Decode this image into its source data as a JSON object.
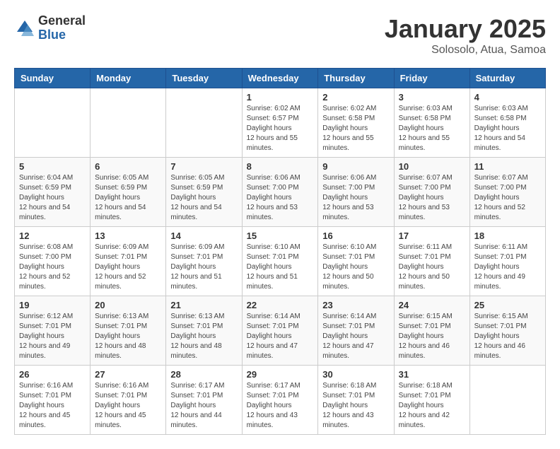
{
  "header": {
    "logo": {
      "general": "General",
      "blue": "Blue"
    },
    "title": "January 2025",
    "location": "Solosolo, Atua, Samoa"
  },
  "weekdays": [
    "Sunday",
    "Monday",
    "Tuesday",
    "Wednesday",
    "Thursday",
    "Friday",
    "Saturday"
  ],
  "weeks": [
    [
      null,
      null,
      null,
      {
        "day": 1,
        "sunrise": "6:02 AM",
        "sunset": "6:57 PM",
        "daylight": "12 hours and 55 minutes."
      },
      {
        "day": 2,
        "sunrise": "6:02 AM",
        "sunset": "6:58 PM",
        "daylight": "12 hours and 55 minutes."
      },
      {
        "day": 3,
        "sunrise": "6:03 AM",
        "sunset": "6:58 PM",
        "daylight": "12 hours and 55 minutes."
      },
      {
        "day": 4,
        "sunrise": "6:03 AM",
        "sunset": "6:58 PM",
        "daylight": "12 hours and 54 minutes."
      }
    ],
    [
      {
        "day": 5,
        "sunrise": "6:04 AM",
        "sunset": "6:59 PM",
        "daylight": "12 hours and 54 minutes."
      },
      {
        "day": 6,
        "sunrise": "6:05 AM",
        "sunset": "6:59 PM",
        "daylight": "12 hours and 54 minutes."
      },
      {
        "day": 7,
        "sunrise": "6:05 AM",
        "sunset": "6:59 PM",
        "daylight": "12 hours and 54 minutes."
      },
      {
        "day": 8,
        "sunrise": "6:06 AM",
        "sunset": "7:00 PM",
        "daylight": "12 hours and 53 minutes."
      },
      {
        "day": 9,
        "sunrise": "6:06 AM",
        "sunset": "7:00 PM",
        "daylight": "12 hours and 53 minutes."
      },
      {
        "day": 10,
        "sunrise": "6:07 AM",
        "sunset": "7:00 PM",
        "daylight": "12 hours and 53 minutes."
      },
      {
        "day": 11,
        "sunrise": "6:07 AM",
        "sunset": "7:00 PM",
        "daylight": "12 hours and 52 minutes."
      }
    ],
    [
      {
        "day": 12,
        "sunrise": "6:08 AM",
        "sunset": "7:00 PM",
        "daylight": "12 hours and 52 minutes."
      },
      {
        "day": 13,
        "sunrise": "6:09 AM",
        "sunset": "7:01 PM",
        "daylight": "12 hours and 52 minutes."
      },
      {
        "day": 14,
        "sunrise": "6:09 AM",
        "sunset": "7:01 PM",
        "daylight": "12 hours and 51 minutes."
      },
      {
        "day": 15,
        "sunrise": "6:10 AM",
        "sunset": "7:01 PM",
        "daylight": "12 hours and 51 minutes."
      },
      {
        "day": 16,
        "sunrise": "6:10 AM",
        "sunset": "7:01 PM",
        "daylight": "12 hours and 50 minutes."
      },
      {
        "day": 17,
        "sunrise": "6:11 AM",
        "sunset": "7:01 PM",
        "daylight": "12 hours and 50 minutes."
      },
      {
        "day": 18,
        "sunrise": "6:11 AM",
        "sunset": "7:01 PM",
        "daylight": "12 hours and 49 minutes."
      }
    ],
    [
      {
        "day": 19,
        "sunrise": "6:12 AM",
        "sunset": "7:01 PM",
        "daylight": "12 hours and 49 minutes."
      },
      {
        "day": 20,
        "sunrise": "6:13 AM",
        "sunset": "7:01 PM",
        "daylight": "12 hours and 48 minutes."
      },
      {
        "day": 21,
        "sunrise": "6:13 AM",
        "sunset": "7:01 PM",
        "daylight": "12 hours and 48 minutes."
      },
      {
        "day": 22,
        "sunrise": "6:14 AM",
        "sunset": "7:01 PM",
        "daylight": "12 hours and 47 minutes."
      },
      {
        "day": 23,
        "sunrise": "6:14 AM",
        "sunset": "7:01 PM",
        "daylight": "12 hours and 47 minutes."
      },
      {
        "day": 24,
        "sunrise": "6:15 AM",
        "sunset": "7:01 PM",
        "daylight": "12 hours and 46 minutes."
      },
      {
        "day": 25,
        "sunrise": "6:15 AM",
        "sunset": "7:01 PM",
        "daylight": "12 hours and 46 minutes."
      }
    ],
    [
      {
        "day": 26,
        "sunrise": "6:16 AM",
        "sunset": "7:01 PM",
        "daylight": "12 hours and 45 minutes."
      },
      {
        "day": 27,
        "sunrise": "6:16 AM",
        "sunset": "7:01 PM",
        "daylight": "12 hours and 45 minutes."
      },
      {
        "day": 28,
        "sunrise": "6:17 AM",
        "sunset": "7:01 PM",
        "daylight": "12 hours and 44 minutes."
      },
      {
        "day": 29,
        "sunrise": "6:17 AM",
        "sunset": "7:01 PM",
        "daylight": "12 hours and 43 minutes."
      },
      {
        "day": 30,
        "sunrise": "6:18 AM",
        "sunset": "7:01 PM",
        "daylight": "12 hours and 43 minutes."
      },
      {
        "day": 31,
        "sunrise": "6:18 AM",
        "sunset": "7:01 PM",
        "daylight": "12 hours and 42 minutes."
      },
      null
    ]
  ]
}
